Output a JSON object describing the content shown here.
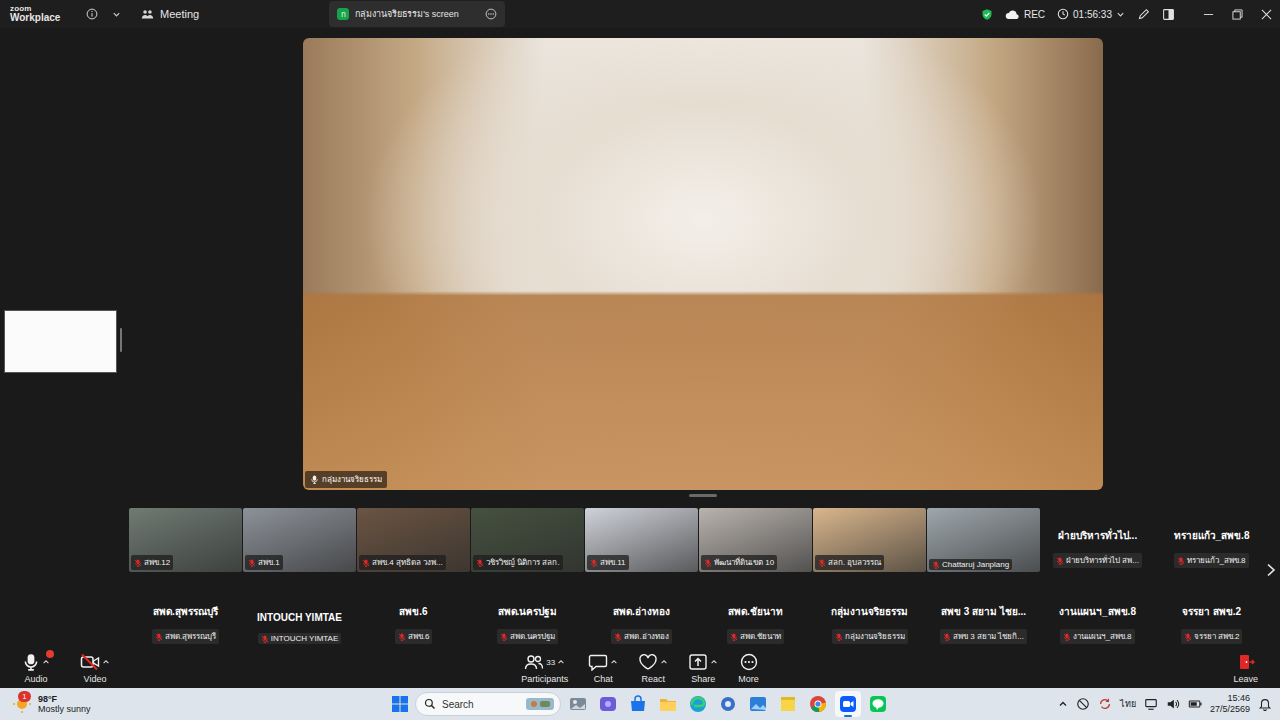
{
  "window": {
    "logo_top": "zoom",
    "logo_bottom": "Workplace"
  },
  "header": {
    "meeting_label": "Meeting",
    "share_tab": {
      "avatar": "ก",
      "label": "กลุ่มงานจริยธรรม's screen",
      "selected": true
    },
    "recording": {
      "label": "REC",
      "on": true
    },
    "timer": "01:56:33"
  },
  "shared_screen": {
    "presenter_label": "กลุ่มงานจริยธรรม",
    "presenter_muted": false
  },
  "gallery": {
    "rows": [
      [
        {
          "kind": "video",
          "label": "สพข.12",
          "muted": true
        },
        {
          "kind": "video",
          "label": "สพข.1",
          "muted": true
        },
        {
          "kind": "video",
          "label": "สพข.4 สุทธิดล วงพ...",
          "muted": true
        },
        {
          "kind": "video",
          "label": "วชิรวิชญ์ นิติการ สลก.",
          "muted": true
        },
        {
          "kind": "video",
          "label": "สพข.11",
          "muted": true
        },
        {
          "kind": "video",
          "label": "พัฒนาที่ดินเขต 10",
          "muted": true
        },
        {
          "kind": "video",
          "label": "สลก. อุบลวรรณ",
          "muted": true
        },
        {
          "kind": "video",
          "label": "Chattaruj Janplang",
          "muted": true
        },
        {
          "kind": "name",
          "title": "ฝ่ายบริหารทั่วไป...",
          "label": "ฝ่ายบริหารทั่วไป สพ...",
          "muted": true
        },
        {
          "kind": "name",
          "title": "ทรายแก้ว_สพข.8",
          "label": "ทรายแก้ว_สพข.8",
          "muted": true
        }
      ],
      [
        {
          "kind": "name",
          "title": "สพด.สุพรรณบุรี",
          "label": "สพด.สุพรรณบุรี",
          "muted": true
        },
        {
          "kind": "name",
          "title": "INTOUCH YIMTAE",
          "label": "INTOUCH YIMTAE",
          "muted": true
        },
        {
          "kind": "name",
          "title": "สพข.6",
          "label": "สพข.6",
          "muted": true
        },
        {
          "kind": "name",
          "title": "สพด.นครปฐม",
          "label": "สพด.นครปฐม",
          "muted": true
        },
        {
          "kind": "name",
          "title": "สพด.อ่างทอง",
          "label": "สพด.อ่างทอง",
          "muted": true
        },
        {
          "kind": "name",
          "title": "สพด.ชัยนาท",
          "label": "สพด.ชัยนาท",
          "muted": true
        },
        {
          "kind": "name",
          "title": "กลุ่มงานจริยธรรม",
          "label": "กลุ่มงานจริยธรรม",
          "muted": true
        },
        {
          "kind": "name",
          "title": "สพข 3 สยาม ไชย...",
          "label": "สพข 3 สยาม ไชยกิ...",
          "muted": true
        },
        {
          "kind": "name",
          "title": "งานแผนฯ_สพข.8",
          "label": "งานแผนฯ_สพข.8",
          "muted": true
        },
        {
          "kind": "name",
          "title": "จรรยา สพข.2",
          "label": "จรรยา สพข.2",
          "muted": true
        }
      ]
    ]
  },
  "toolbar": {
    "left": [
      {
        "kind": "audio",
        "label": "Audio",
        "alert": true,
        "off": false
      },
      {
        "kind": "video",
        "label": "Video",
        "alert": false,
        "off": true
      }
    ],
    "center": [
      {
        "kind": "participants",
        "label": "Participants",
        "count": "33",
        "menu": true
      },
      {
        "kind": "chat",
        "label": "Chat",
        "count": "",
        "menu": true
      },
      {
        "kind": "react",
        "label": "React",
        "count": "",
        "menu": true
      },
      {
        "kind": "share",
        "label": "Share",
        "count": "",
        "menu": true
      },
      {
        "kind": "more",
        "label": "More",
        "count": "",
        "menu": false
      }
    ],
    "leave": {
      "label": "Leave"
    }
  },
  "taskbar": {
    "weather": {
      "temp": "98°F",
      "condition": "Mostly sunny",
      "badge": "1"
    },
    "search": {
      "placeholder": "Search"
    },
    "apps": [
      {
        "kind": "gallery",
        "selected": false
      },
      {
        "kind": "copilot",
        "selected": false
      },
      {
        "kind": "store",
        "selected": false
      },
      {
        "kind": "folder",
        "selected": false
      },
      {
        "kind": "edge",
        "selected": false
      },
      {
        "kind": "settings",
        "selected": false
      },
      {
        "kind": "photos",
        "selected": false
      },
      {
        "kind": "notes",
        "selected": false
      },
      {
        "kind": "chrome",
        "selected": false
      },
      {
        "kind": "zoom",
        "selected": true
      },
      {
        "kind": "line",
        "selected": false
      }
    ],
    "tray": {
      "language": "ไทย"
    },
    "clock": {
      "time": "15:46",
      "date": "27/5/2569"
    }
  }
}
